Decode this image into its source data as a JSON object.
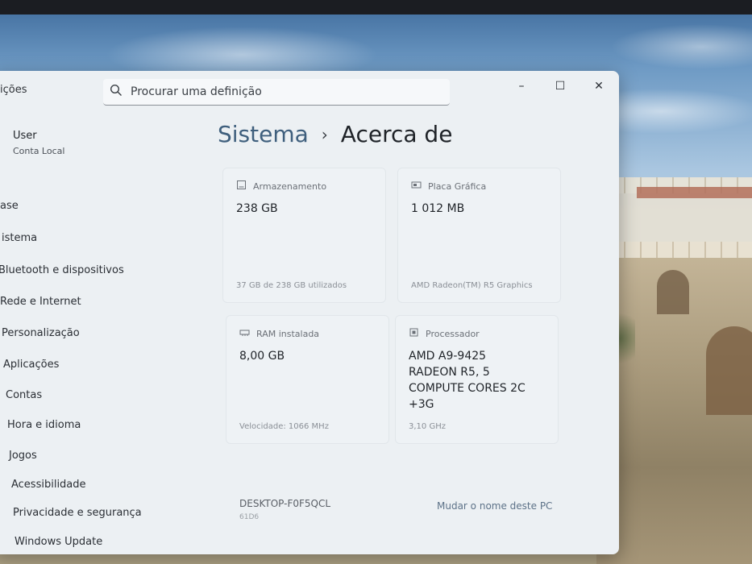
{
  "window": {
    "title_fragment": "ições",
    "search_placeholder": "Procurar uma definição",
    "controls": {
      "minimize": "–",
      "maximize": "☐",
      "close": "✕"
    }
  },
  "user": {
    "name": "User",
    "account_type": "Conta Local"
  },
  "sidebar": {
    "items": [
      {
        "label": "ase"
      },
      {
        "label": "istema"
      },
      {
        "label": "Bluetooth e dispositivos"
      },
      {
        "label": "Rede e Internet"
      },
      {
        "label": "Personalização"
      },
      {
        "label": "Aplicações"
      },
      {
        "label": "Contas"
      },
      {
        "label": "Hora e idioma"
      },
      {
        "label": "Jogos"
      },
      {
        "label": "Acessibilidade"
      },
      {
        "label": "Privacidade e segurança"
      },
      {
        "label": "Windows Update"
      }
    ]
  },
  "breadcrumb": {
    "parent": "Sistema",
    "separator": "›",
    "current": "Acerca de"
  },
  "specs": {
    "storage": {
      "label": "Armazenamento",
      "value": "238 GB",
      "detail": "37 GB de 238 GB utilizados",
      "icon": "storage-icon"
    },
    "gpu": {
      "label": "Placa Gráfica",
      "value": "1 012 MB",
      "detail": "AMD Radeon(TM) R5 Graphics",
      "icon": "graphics-card-icon"
    },
    "ram": {
      "label": "RAM instalada",
      "value": "8,00 GB",
      "detail": "Velocidade: 1066 MHz",
      "icon": "memory-icon"
    },
    "cpu": {
      "label": "Processador",
      "value_lines": [
        "AMD A9-9425",
        "RADEON R5, 5",
        "COMPUTE CORES 2C",
        "+3G"
      ],
      "detail": "3,10 GHz",
      "icon": "processor-icon"
    }
  },
  "device": {
    "name": "DESKTOP-F0F5QCL",
    "sub": "61D6",
    "rename_label": "Mudar o nome deste PC"
  },
  "colors": {
    "window_bg": "#ecf0f3",
    "breadcrumb_parent": "#3f5f7d",
    "link": "#5d7288"
  }
}
